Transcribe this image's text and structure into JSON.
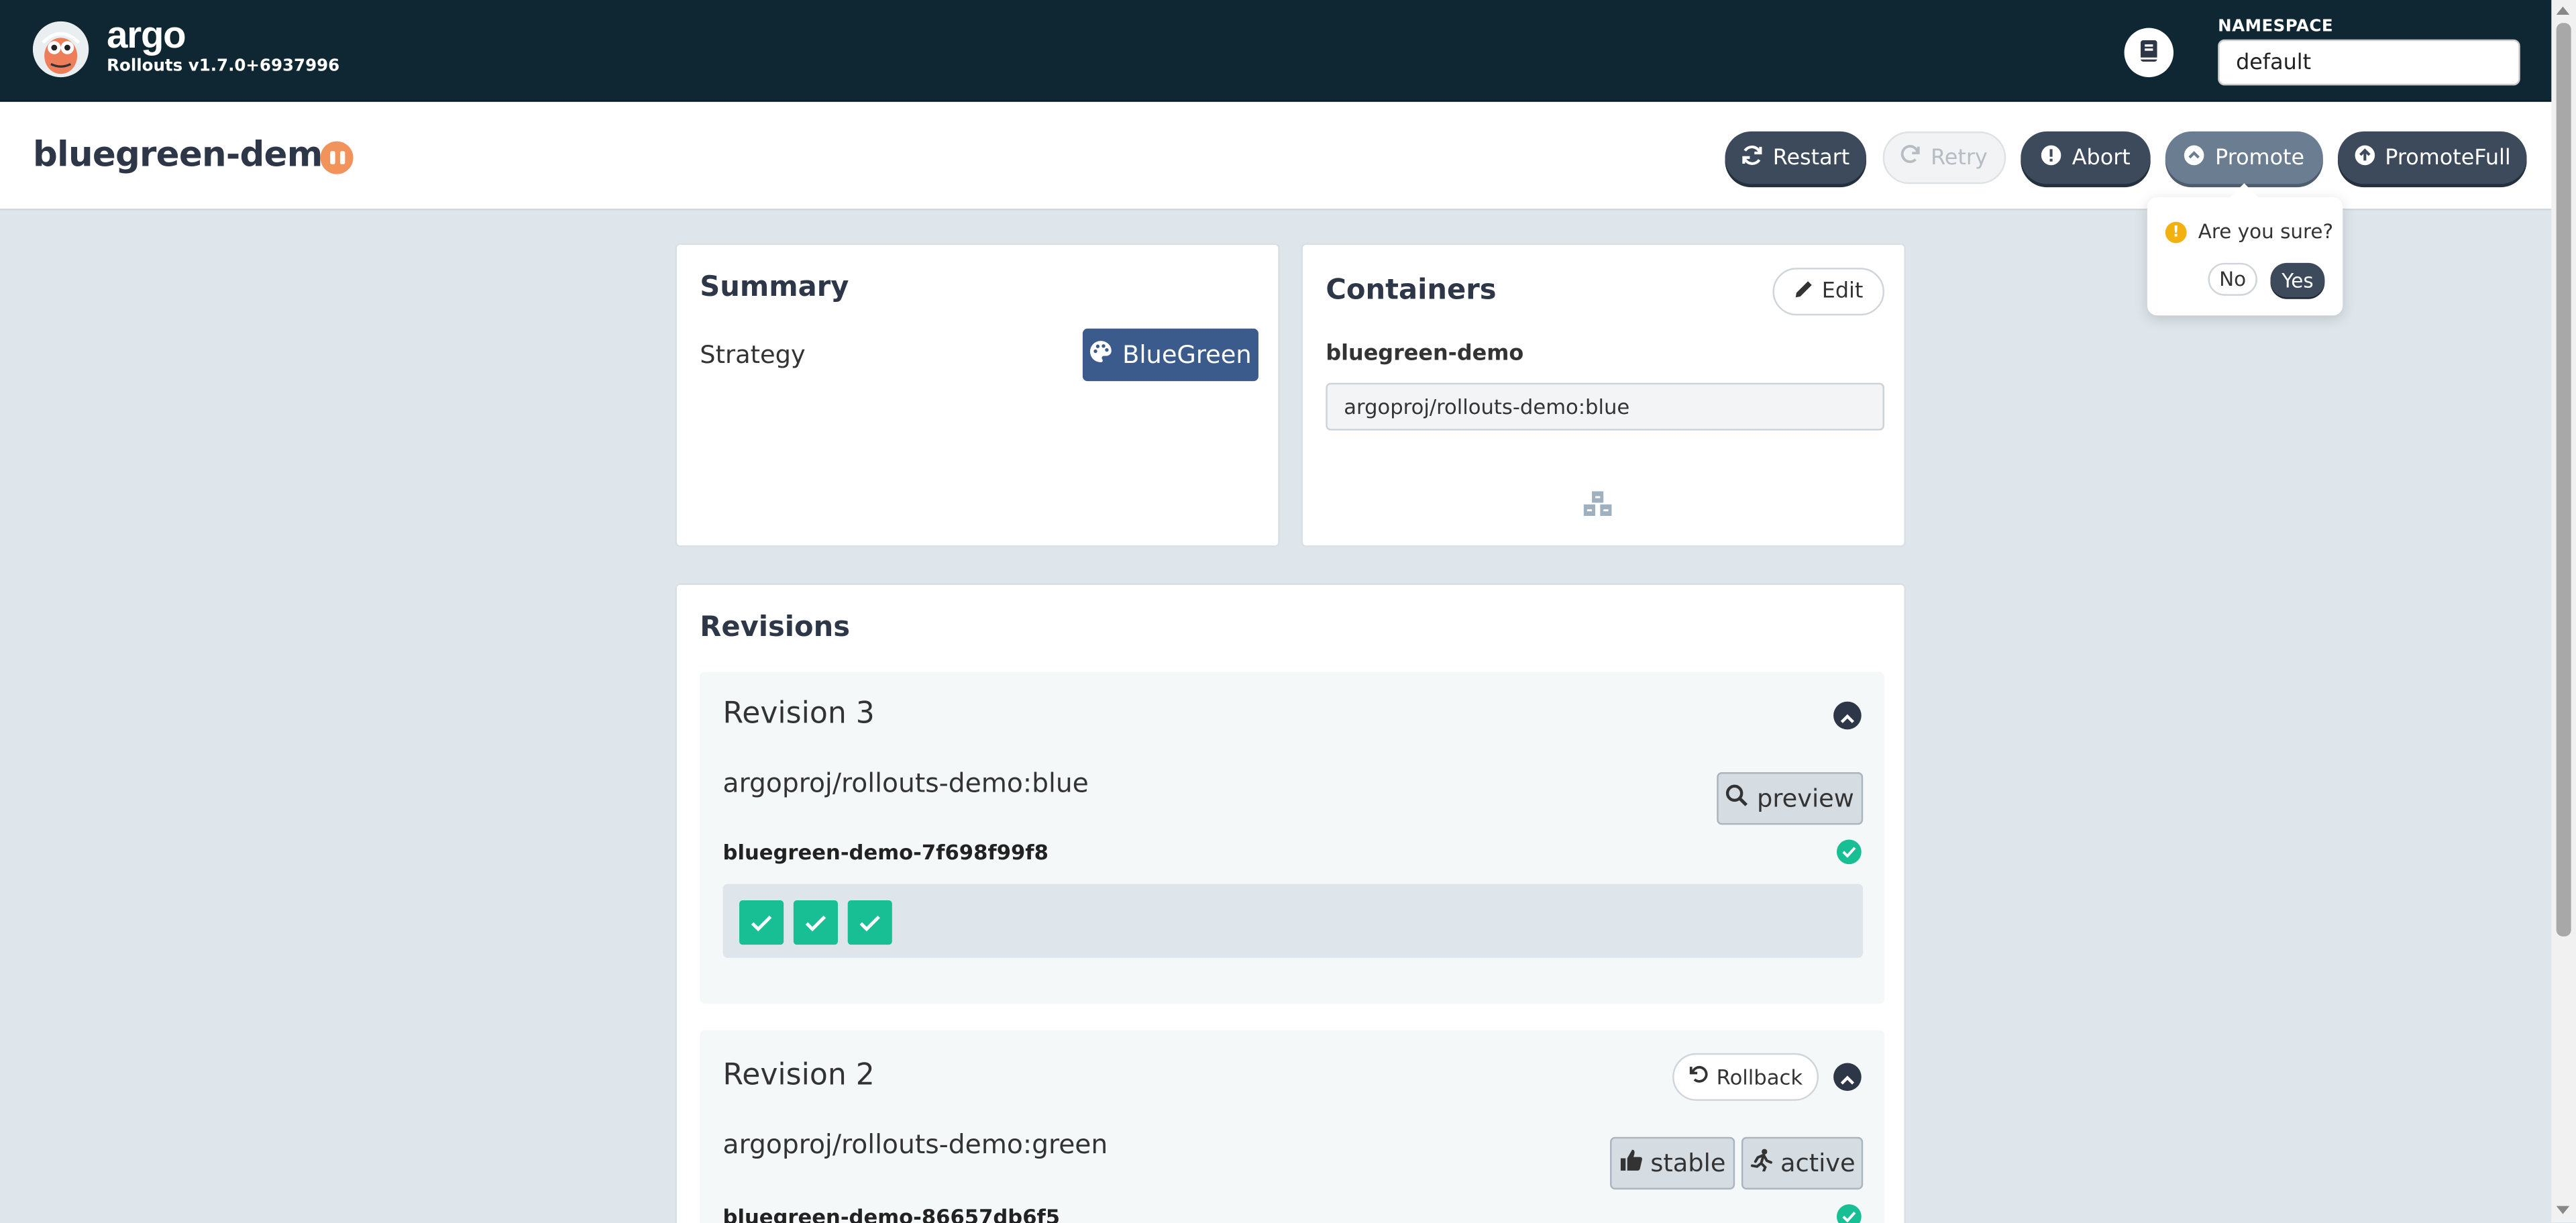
{
  "topbar": {
    "brand": "argo",
    "version": "Rollouts v1.7.0+6937996",
    "namespace_label": "NAMESPACE",
    "namespace_value": "default"
  },
  "header": {
    "title": "bluegreen-demo",
    "status": "paused",
    "buttons": {
      "restart": "Restart",
      "retry": "Retry",
      "abort": "Abort",
      "promote": "Promote",
      "promote_full": "PromoteFull"
    }
  },
  "confirm": {
    "question": "Are you sure?",
    "no": "No",
    "yes": "Yes"
  },
  "summary": {
    "title": "Summary",
    "strategy_label": "Strategy",
    "strategy_value": "BlueGreen"
  },
  "containers": {
    "title": "Containers",
    "edit_label": "Edit",
    "items": [
      {
        "name": "bluegreen-demo",
        "image": "argoproj/rollouts-demo:blue"
      }
    ]
  },
  "revisions": {
    "title": "Revisions",
    "items": [
      {
        "title": "Revision 3",
        "image": "argoproj/rollouts-demo:blue",
        "tags": [
          "preview"
        ],
        "replicaset": "bluegreen-demo-7f698f99f8",
        "pods_ready": 3
      },
      {
        "title": "Revision 2",
        "rollback_label": "Rollback",
        "image": "argoproj/rollouts-demo:green",
        "tags": [
          "stable",
          "active"
        ],
        "replicaset": "bluegreen-demo-86657db6f5"
      }
    ]
  },
  "colors": {
    "topbar": "#0f2733",
    "button": "#3c4a5c",
    "healthy": "#18be94",
    "paused": "#f2935c",
    "strategy_badge": "#3a5b8c"
  }
}
